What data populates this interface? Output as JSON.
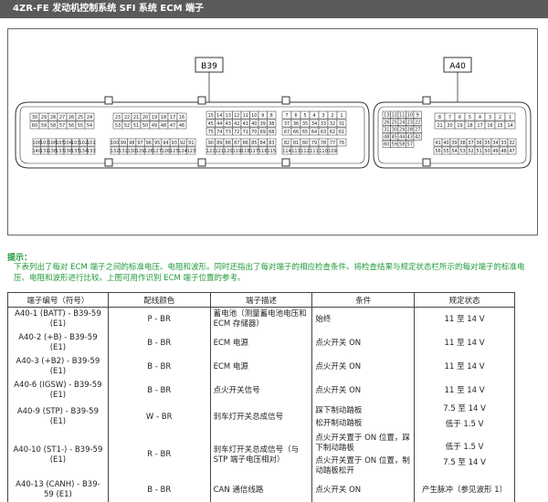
{
  "header": {
    "title": "4ZR-FE 发动机控制系统  SFI 系统  ECM 端子"
  },
  "diagram": {
    "left_label": "B39",
    "right_label": "A40",
    "b39_rows": [
      [
        "30",
        "29",
        "28",
        "27",
        "26",
        "25",
        "24"
      ],
      [
        "60",
        "59",
        "58",
        "57",
        "56",
        "55",
        "54"
      ],
      [
        "23",
        "22",
        "21",
        "20",
        "19",
        "18",
        "17",
        "16"
      ],
      [
        "53",
        "52",
        "51",
        "50",
        "49",
        "48",
        "47",
        "46"
      ],
      [
        "15",
        "14",
        "13",
        "12",
        "11",
        "10",
        "9",
        "8"
      ],
      [
        "45",
        "44",
        "43",
        "42",
        "41",
        "40",
        "39",
        "38"
      ],
      [
        "75",
        "74",
        "73",
        "72",
        "71",
        "70",
        "69",
        "68"
      ],
      [
        "7",
        "6",
        "5",
        "4",
        "3",
        "2",
        "1"
      ],
      [
        "37",
        "36",
        "35",
        "34",
        "33",
        "32",
        "31"
      ],
      [
        "67",
        "66",
        "65",
        "64",
        "63",
        "62",
        "61"
      ]
    ],
    "b39_bottom": [
      [
        "108",
        "107",
        "106",
        "105",
        "104",
        "103",
        "102",
        "101"
      ],
      [
        "140",
        "139",
        "138",
        "137",
        "136",
        "135",
        "134",
        "133"
      ],
      [
        "100",
        "99",
        "98",
        "97",
        "96",
        "95",
        "94",
        "93",
        "92",
        "91"
      ],
      [
        "132",
        "131",
        "130",
        "129",
        "128",
        "127",
        "126",
        "125",
        "124",
        "123"
      ],
      [
        "90",
        "89",
        "88",
        "87",
        "86",
        "85",
        "84",
        "83"
      ],
      [
        "122",
        "121",
        "120",
        "119",
        "118",
        "117",
        "116",
        "115"
      ],
      [
        "82",
        "81",
        "80",
        "79",
        "78",
        "77",
        "76"
      ],
      [
        "114",
        "113",
        "112",
        "111",
        "110",
        "109"
      ]
    ],
    "a40_rows": [
      [
        "13",
        "12",
        "11",
        "10",
        "9"
      ],
      [
        "26",
        "25",
        "24",
        "23",
        "22"
      ],
      [
        "31",
        "30",
        "29",
        "28",
        "27"
      ],
      [
        "48",
        "45",
        "44",
        "43",
        "42"
      ],
      [
        "60",
        "59",
        "58",
        "57"
      ],
      [
        "8",
        "7",
        "6",
        "5",
        "4",
        "3",
        "2",
        "1"
      ],
      [
        "21",
        "20",
        "19",
        "18",
        "17",
        "16",
        "15",
        "14"
      ],
      [
        "41",
        "40",
        "39",
        "38",
        "37",
        "36",
        "35",
        "34",
        "33",
        "32"
      ],
      [
        "56",
        "55",
        "54",
        "53",
        "52",
        "51",
        "50",
        "49",
        "48",
        "47"
      ]
    ]
  },
  "hint": {
    "title": "提示：",
    "text": "下表列出了每对 ECM 端子之间的标准电压、电阻和波形。同时还指出了每对端子的相应检查条件。将检查结果与规定状态栏所示的每对端子的标准电压、电阻和波形进行比较。上图可用作识别 ECM 端子位置的参考。"
  },
  "table": {
    "headers": [
      "端子编号（符号）",
      "配线颜色",
      "端子描述",
      "条件",
      "规定状态"
    ],
    "rows": [
      {
        "terminal": "A40-1 (BATT) - B39-59 (E1)",
        "color": "P - BR",
        "desc": "蓄电池（测量蓄电池电压和 ECM 存储器）",
        "conds": [
          "始终"
        ],
        "specs": [
          "11 至 14 V"
        ]
      },
      {
        "terminal": "A40-2 (+B) - B39-59 (E1)",
        "color": "B - BR",
        "desc": "ECM 电源",
        "conds": [
          "点火开关 ON"
        ],
        "specs": [
          "11 至 14 V"
        ]
      },
      {
        "terminal": "A40-3 (+B2) - B39-59 (E1)",
        "color": "B - BR",
        "desc": "ECM 电源",
        "conds": [
          "点火开关 ON"
        ],
        "specs": [
          "11 至 14 V"
        ]
      },
      {
        "terminal": "A40-6 (IGSW) - B39-59 (E1)",
        "color": "B - BR",
        "desc": "点火开关信号",
        "conds": [
          "点火开关 ON"
        ],
        "specs": [
          "11 至 14 V"
        ]
      },
      {
        "terminal": "A40-9 (STP) - B39-59 (E1)",
        "color": "W - BR",
        "desc": "刹车灯开关总成信号",
        "conds": [
          "踩下制动踏板",
          "松开制动踏板"
        ],
        "specs": [
          "7.5 至 14 V",
          "低于 1.5 V"
        ]
      },
      {
        "terminal": "A40-10 (ST1-) - B39-59 (E1)",
        "color": "R - BR",
        "desc": "刹车灯开关总成信号（与 STP 端子电压相对）",
        "conds": [
          "点火开关置于 ON 位置，踩下制动踏板",
          "点火开关置于 ON 位置，制动踏板松开"
        ],
        "specs": [
          "低于 1.5 V",
          "7.5 至 14 V"
        ]
      },
      {
        "terminal": "A40-13 (CANH) - B39-59 (E1)",
        "color": "B - BR",
        "desc": "CAN 通信线路",
        "conds": [
          "点火开关 ON"
        ],
        "specs": [
          "产生脉冲（参见波形 1）"
        ]
      }
    ]
  }
}
